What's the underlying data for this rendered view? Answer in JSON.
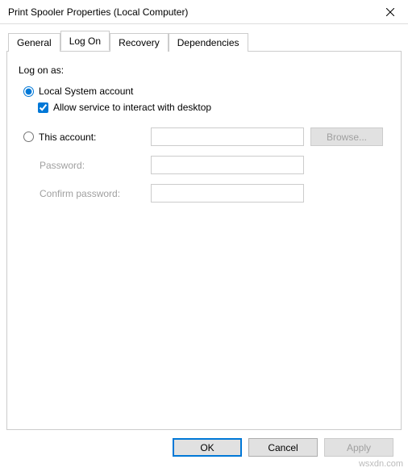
{
  "window": {
    "title": "Print Spooler Properties (Local Computer)"
  },
  "tabs": {
    "general": "General",
    "logon": "Log On",
    "recovery": "Recovery",
    "dependencies": "Dependencies"
  },
  "panel": {
    "section_title": "Log on as:",
    "local_system_label": "Local System account",
    "interact_label": "Allow service to interact with desktop",
    "this_account_label": "This account:",
    "password_label": "Password:",
    "confirm_password_label": "Confirm password:",
    "browse_label": "Browse...",
    "account_value": "",
    "password_value": "",
    "confirm_value": ""
  },
  "buttons": {
    "ok": "OK",
    "cancel": "Cancel",
    "apply": "Apply"
  },
  "watermark": "wsxdn.com"
}
